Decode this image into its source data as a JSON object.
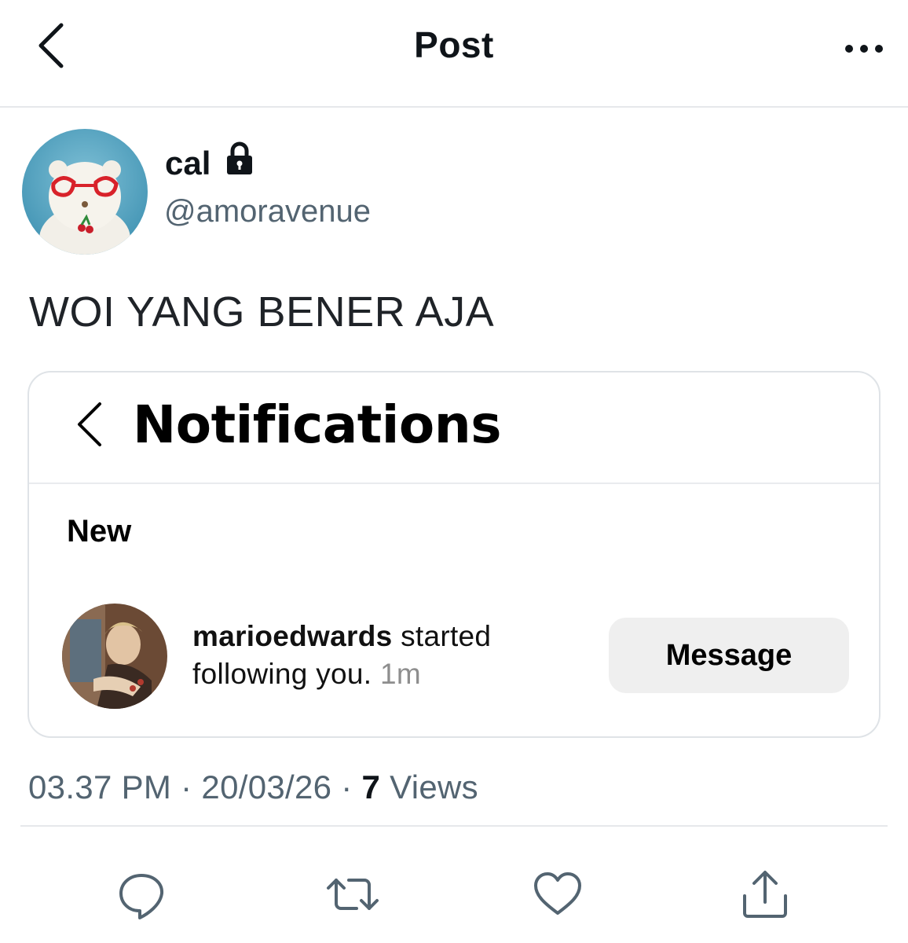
{
  "header": {
    "title": "Post"
  },
  "author": {
    "display_name": "cal",
    "handle": "@amoravenue",
    "protected": true
  },
  "tweet": {
    "text": "WOI YANG BENER AJA"
  },
  "embed": {
    "title": "Notifications",
    "section": "New",
    "notification": {
      "username": "marioedwards",
      "text_line1": " started",
      "text_line2": "following you.",
      "time": "1m",
      "button_label": "Message"
    }
  },
  "meta": {
    "time": "03.37 PM",
    "sep1": " · ",
    "date": "20/03/26",
    "sep2": " · ",
    "views_count": "7",
    "views_label": " Views"
  },
  "actions": {
    "reply_icon": "reply-icon",
    "retweet_icon": "retweet-icon",
    "like_icon": "heart-icon",
    "share_icon": "share-icon"
  },
  "colors": {
    "secondary_text": "#536471",
    "message_button_bg": "#efefef"
  }
}
